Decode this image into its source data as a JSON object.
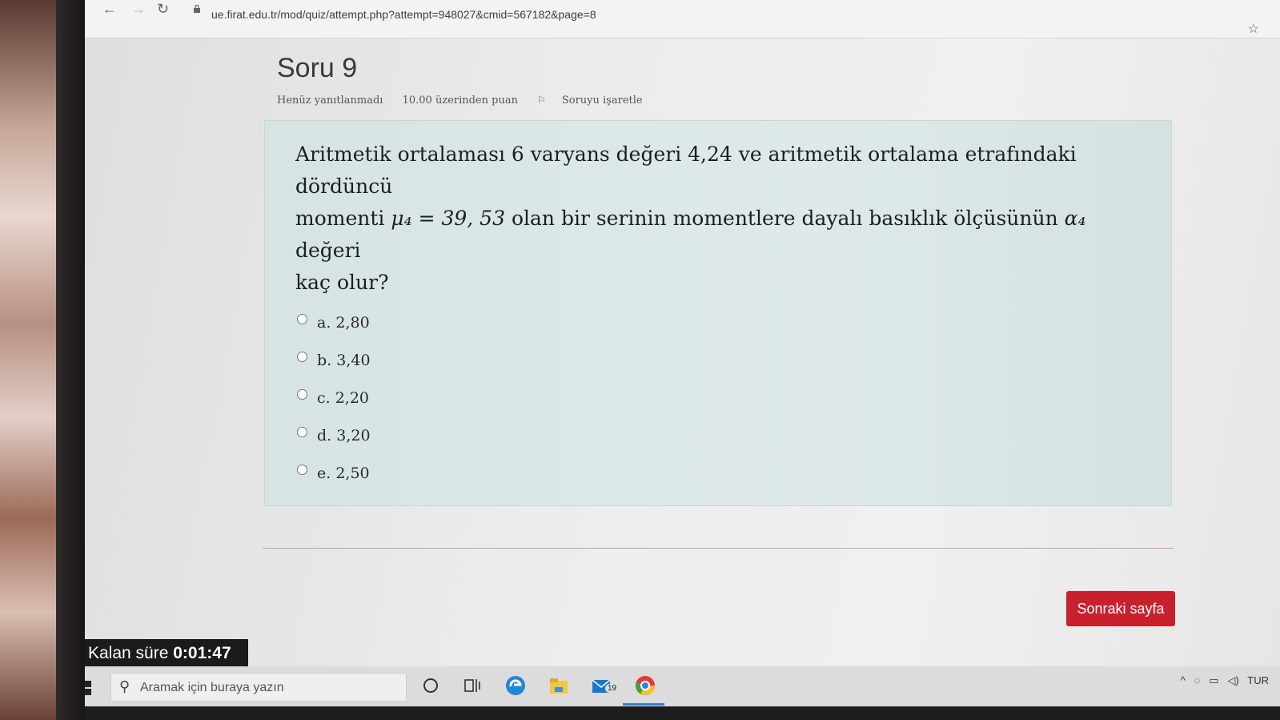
{
  "browser": {
    "url": "ue.firat.edu.tr/mod/quiz/attempt.php?attempt=948027&cmid=567182&page=8"
  },
  "question": {
    "title": "Soru 9",
    "status": "Henüz yanıtlanmadı",
    "points": "10.00 üzerinden puan",
    "flag_label": "Soruyu işaretle",
    "text_line1": "Aritmetik ortalaması 6 varyans değeri 4,24 ve aritmetik ortalama etrafındaki dördüncü",
    "text_line2_a": "momenti ",
    "math_mu": "μ₄ = 39, 53",
    "text_line2_b": " olan bir serinin momentlere dayalı basıklık ölçüsünün ",
    "math_alpha": "α₄",
    "text_line2_c": " değeri",
    "text_line3": "kaç olur?",
    "answers": [
      {
        "label": "a. 2,80"
      },
      {
        "label": "b. 3,40"
      },
      {
        "label": "c. 2,20"
      },
      {
        "label": "d. 3,20"
      },
      {
        "label": "e. 2,50"
      }
    ]
  },
  "navigation": {
    "next_label": "Sonraki sayfa"
  },
  "timer": {
    "label": "Kalan süre ",
    "value": "0:01:47"
  },
  "taskbar": {
    "search_placeholder": "Aramak için buraya yazın",
    "mail_badge": "19",
    "language": "TUR"
  }
}
